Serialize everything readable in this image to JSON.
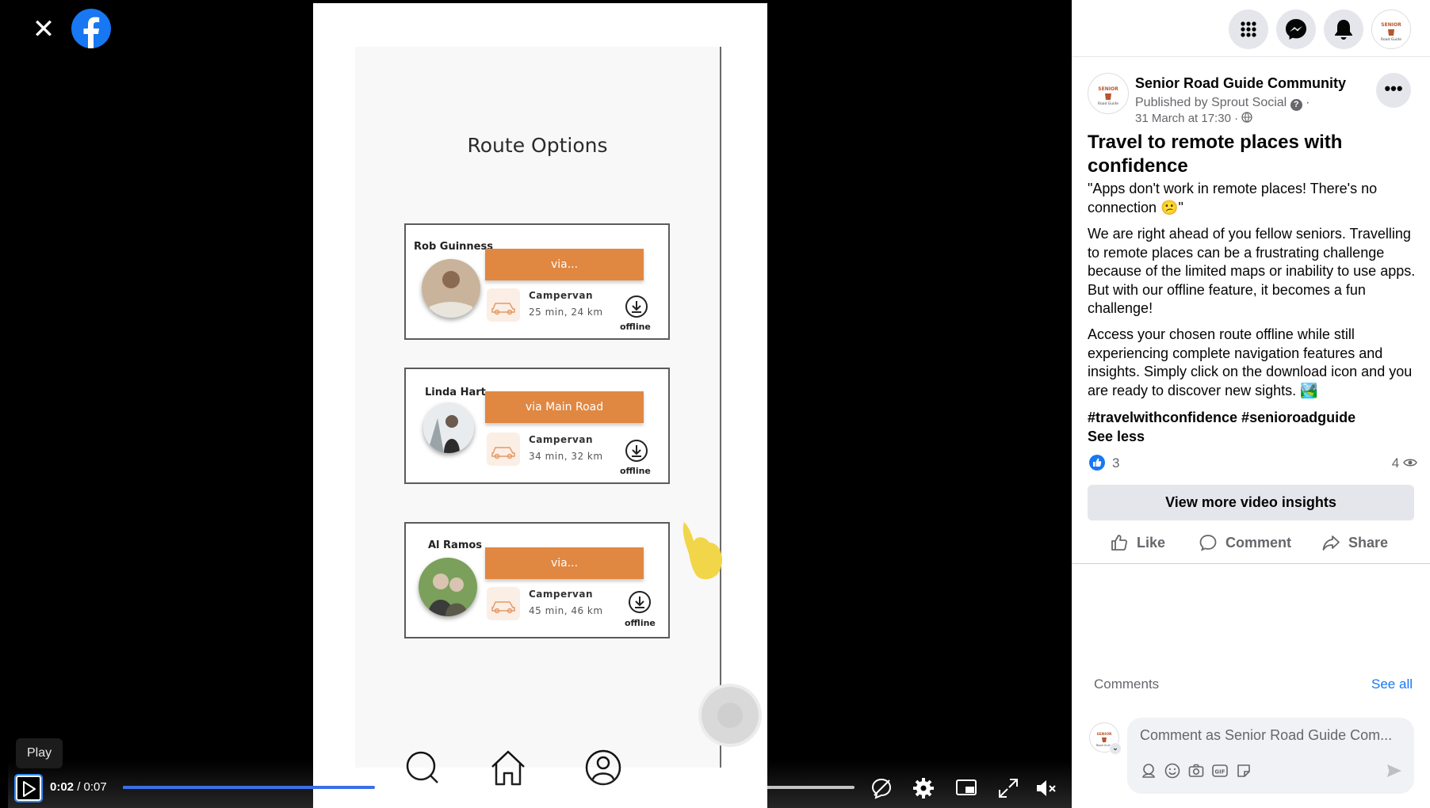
{
  "viewer": {
    "close_icon": "close-icon",
    "logo": "facebook-logo"
  },
  "video_content": {
    "screen_title": "Route Options",
    "routes": [
      {
        "name": "Rob Guinness",
        "via": "via...",
        "mode": "Campervan",
        "time": "25 min, 24 km",
        "offline": "offline"
      },
      {
        "name": "Linda Hart",
        "via": "via Main Road",
        "mode": "Campervan",
        "time": "34 min, 32 km",
        "offline": "offline"
      },
      {
        "name": "Al Ramos",
        "via": "via...",
        "mode": "Campervan",
        "time": "45 min, 46 km",
        "offline": "offline"
      }
    ],
    "accent_color": "#e08742"
  },
  "player": {
    "tooltip": "Play",
    "current_time": "0:02",
    "separator": " / ",
    "duration": "0:07",
    "progress_fraction": 0.345
  },
  "post": {
    "page_name": "Senior Road Guide Community",
    "published_by": "Published by Sprout Social",
    "date": "31 March at 17:30 ·",
    "title": "Travel to remote places with confidence",
    "quote": "\"Apps don't work in remote places! There's no connection 😕\"",
    "para1": "We are right ahead of you fellow seniors. Travelling to remote places can be a frustrating challenge because of the limited maps or inability to use apps. But with our offline feature, it becomes a fun challenge!",
    "para2": "Access your chosen route offline while still experiencing complete navigation features and insights. Simply click on the download icon and you are ready to discover new sights. 🏞️",
    "hashtags": "#travelwithconfidence #senioroadguide",
    "see_less": "See less",
    "like_count": "3",
    "view_count": "4",
    "insights_button": "View more video insights",
    "actions": {
      "like": "Like",
      "comment": "Comment",
      "share": "Share"
    },
    "comments_label": "Comments",
    "see_all": "See all",
    "comment_placeholder": "Comment as Senior Road Guide Com..."
  }
}
